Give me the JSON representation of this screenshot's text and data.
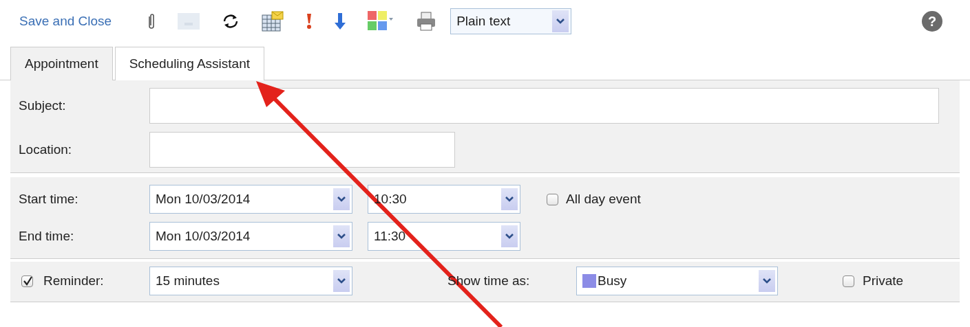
{
  "toolbar": {
    "save": "Save and Close",
    "format": {
      "value": "Plain text"
    },
    "help": "?"
  },
  "tabs": [
    {
      "label": "Appointment",
      "selected": true
    },
    {
      "label": "Scheduling Assistant",
      "selected": false
    }
  ],
  "subject": {
    "label": "Subject:"
  },
  "location": {
    "label": "Location:"
  },
  "start": {
    "label": "Start time:",
    "date": "Mon 10/03/2014",
    "time": "10:30"
  },
  "end": {
    "label": "End time:",
    "date": "Mon 10/03/2014",
    "time": "11:30"
  },
  "all_day": {
    "label": "All day event",
    "checked": false
  },
  "reminder": {
    "label": "Reminder:",
    "checked": true,
    "value": "15 minutes"
  },
  "show_time_as": {
    "label": "Show time as:",
    "value": "Busy",
    "color": "#8c8ce6"
  },
  "private": {
    "label": "Private",
    "checked": false
  }
}
